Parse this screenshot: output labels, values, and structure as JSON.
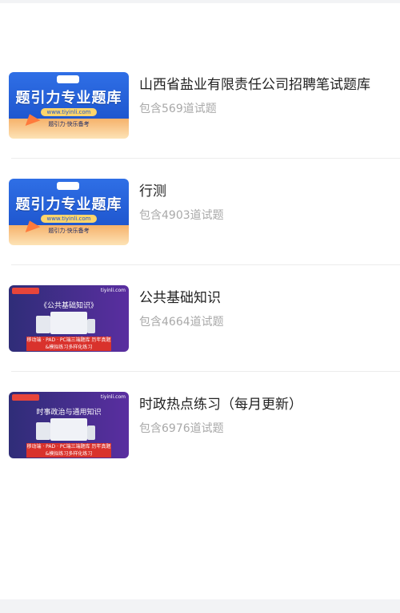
{
  "items": [
    {
      "title": "山西省盐业有限责任公司招聘笔试题库",
      "count": "包含569道试题",
      "thumb": {
        "style": "blue",
        "headline": "题引力专业题库",
        "url": "www.tiyinli.com",
        "footer": "题引力·快乐备考"
      }
    },
    {
      "title": "行测",
      "count": "包含4903道试题",
      "thumb": {
        "style": "blue",
        "headline": "题引力专业题库",
        "url": "www.tiyinli.com",
        "footer": "题引力·快乐备考"
      }
    },
    {
      "title": "公共基础知识",
      "count": "包含4664道试题",
      "thumb": {
        "style": "purple",
        "headline": "《公共基础知识》",
        "brand": "tiyinli.com",
        "band": "移动端 · PAD · PC端三端题库 历年真题&模拟练习多样化练习"
      }
    },
    {
      "title": "时政热点练习（每月更新）",
      "count": "包含6976道试题",
      "thumb": {
        "style": "purple",
        "headline": "时事政治与通用知识",
        "brand": "tiyinli.com",
        "band": "移动端 · PAD · PC端三端题库 历年真题&模拟练习多样化练习"
      }
    }
  ]
}
